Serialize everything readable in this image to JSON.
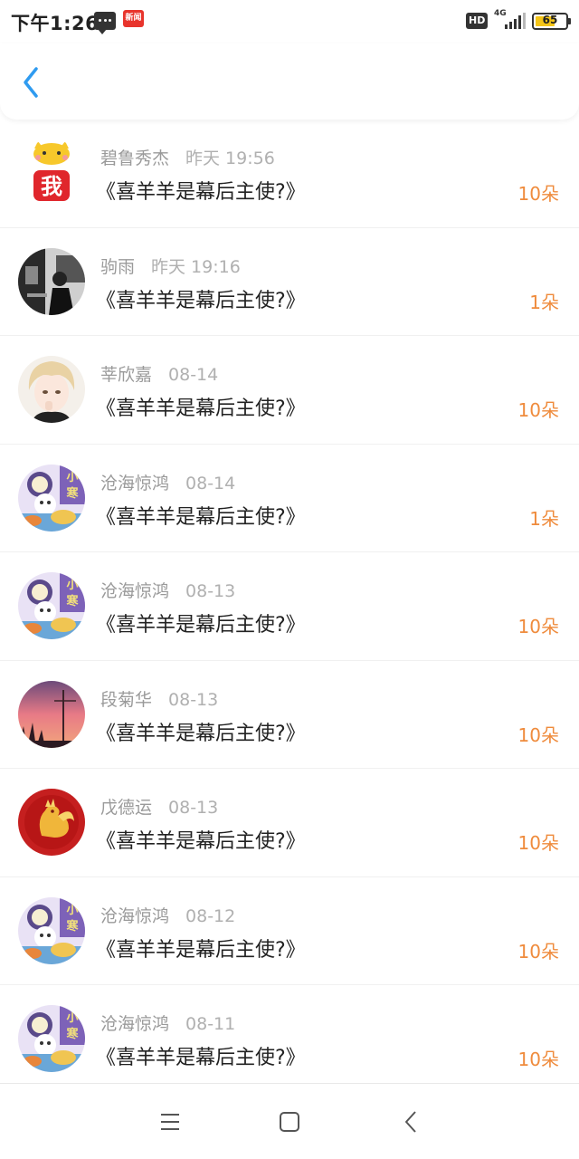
{
  "status_bar": {
    "time": "下午1:26",
    "news_icon_label": "新闻",
    "hd_label": "HD",
    "network_label": "4G",
    "battery_level": "65"
  },
  "header": {
    "back_icon": "chevron-left-icon",
    "accent_color": "#2f9bf0"
  },
  "accent_count_color": "#ef8b3c",
  "items": [
    {
      "name": "碧鲁秀杰",
      "time": "昨天 19:56",
      "title": "《喜羊羊是幕后主使?》",
      "count": "10朵",
      "avatar": "cat-wo-avatar"
    },
    {
      "name": "驹雨",
      "time": "昨天 19:16",
      "title": "《喜羊羊是幕后主使?》",
      "count": "1朵",
      "avatar": "bw-photo-avatar"
    },
    {
      "name": "莘欣嘉",
      "time": "08-14",
      "title": "《喜羊羊是幕后主使?》",
      "count": "10朵",
      "avatar": "anime-boy-avatar"
    },
    {
      "name": "沧海惊鸿",
      "time": "08-14",
      "title": "《喜羊羊是幕后主使?》",
      "count": "1朵",
      "avatar": "cartoon-xiaoman-avatar"
    },
    {
      "name": "沧海惊鸿",
      "time": "08-13",
      "title": "《喜羊羊是幕后主使?》",
      "count": "10朵",
      "avatar": "cartoon-xiaoman-avatar"
    },
    {
      "name": "段菊华",
      "time": "08-13",
      "title": "《喜羊羊是幕后主使?》",
      "count": "10朵",
      "avatar": "sunset-avatar"
    },
    {
      "name": "戊德运",
      "time": "08-13",
      "title": "《喜羊羊是幕后主使?》",
      "count": "10朵",
      "avatar": "golden-rooster-avatar"
    },
    {
      "name": "沧海惊鸿",
      "time": "08-12",
      "title": "《喜羊羊是幕后主使?》",
      "count": "10朵",
      "avatar": "cartoon-xiaoman-avatar"
    },
    {
      "name": "沧海惊鸿",
      "time": "08-11",
      "title": "《喜羊羊是幕后主使?》",
      "count": "10朵",
      "avatar": "cartoon-xiaoman-avatar"
    }
  ],
  "nav": {
    "menu_icon": "menu-icon",
    "home_icon": "home-square-icon",
    "back_icon": "back-triangle-icon"
  }
}
